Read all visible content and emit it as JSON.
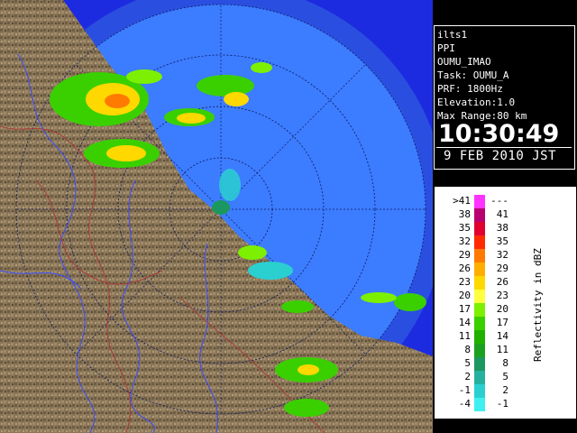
{
  "info": {
    "lines": [
      "ilts1",
      "PPI",
      "OUMU_IMAO",
      "Task: OUMU_A",
      "PRF: 1800Hz",
      "Elevation:1.0",
      "Max Range:80 km"
    ],
    "time": "10:30:49",
    "date": "9 FEB 2010 JST"
  },
  "legend": {
    "title": "Reflectivity in dBZ",
    "rows": [
      {
        "lo": ">41",
        "hi": "---",
        "color": "#ff33ff"
      },
      {
        "lo": "38",
        "hi": "41",
        "color": "#b8006e"
      },
      {
        "lo": "35",
        "hi": "38",
        "color": "#e00030"
      },
      {
        "lo": "32",
        "hi": "35",
        "color": "#ff2a00"
      },
      {
        "lo": "29",
        "hi": "32",
        "color": "#ff7a00"
      },
      {
        "lo": "26",
        "hi": "29",
        "color": "#ffae00"
      },
      {
        "lo": "23",
        "hi": "26",
        "color": "#ffd800"
      },
      {
        "lo": "20",
        "hi": "23",
        "color": "#ffff40"
      },
      {
        "lo": "17",
        "hi": "20",
        "color": "#7cf000"
      },
      {
        "lo": "14",
        "hi": "17",
        "color": "#3ad000"
      },
      {
        "lo": "11",
        "hi": "14",
        "color": "#20b000"
      },
      {
        "lo": "8",
        "hi": "11",
        "color": "#1ca020"
      },
      {
        "lo": "5",
        "hi": "8",
        "color": "#1a9860"
      },
      {
        "lo": "2",
        "hi": "5",
        "color": "#26b0a0"
      },
      {
        "lo": "-1",
        "hi": "2",
        "color": "#2ad0d0"
      },
      {
        "lo": "-4",
        "hi": "-1",
        "color": "#40f0f0"
      }
    ]
  },
  "map": {
    "colors": {
      "range_disk": "#3c7cff",
      "outer_ring": "#2a4fe0",
      "terrain": "#8a7658",
      "sea": "#1d2be0"
    },
    "range_rings_km": [
      20,
      40,
      60,
      80
    ],
    "radar_site": "OUMU"
  }
}
